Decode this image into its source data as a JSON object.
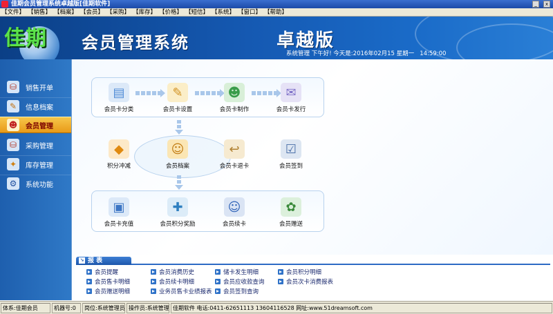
{
  "window": {
    "title": "佳期会员管理系统卓越版[佳期软件]",
    "min_label": "_",
    "close_label": "x"
  },
  "menu": [
    "【文件】",
    "【销售】",
    "【档案】",
    "【会员】",
    "【采购】",
    "【库存】",
    "【价格】",
    "【短信】",
    "【系统】",
    "【窗口】",
    "【帮助】"
  ],
  "banner": {
    "logo": "佳期",
    "app_title": "会员管理系统",
    "edition": "卓越版",
    "status_line": "系统管理 下午好! 今天是:2016年02月15 星期一   14:59:00"
  },
  "sidebar": {
    "items": [
      {
        "label": "销售开单",
        "icon": "cart-icon"
      },
      {
        "label": "信息档案",
        "icon": "archive-icon"
      },
      {
        "label": "会员管理",
        "icon": "member-icon",
        "active": true
      },
      {
        "label": "采购管理",
        "icon": "purchase-icon"
      },
      {
        "label": "库存管理",
        "icon": "inventory-icon"
      },
      {
        "label": "系统功能",
        "icon": "system-icon"
      }
    ]
  },
  "main": {
    "tiles": [
      {
        "label": "会员卡分类",
        "icon": "card-category-icon",
        "color": "#4f8bd6",
        "glyph": "▤"
      },
      {
        "label": "会员卡设置",
        "icon": "card-settings-icon",
        "color": "#e8b23a",
        "glyph": "✎"
      },
      {
        "label": "会员卡制作",
        "icon": "card-make-icon",
        "color": "#3a9c4a",
        "glyph": "☻"
      },
      {
        "label": "会员卡发行",
        "icon": "card-issue-icon",
        "color": "#7d6fc8",
        "glyph": "✉"
      },
      {
        "label": "积分冲减",
        "icon": "points-deduct-icon",
        "color": "#f0a030",
        "glyph": "◆"
      },
      {
        "label": "会员档案",
        "icon": "member-archive-icon",
        "color": "#e0a020",
        "glyph": "☺"
      },
      {
        "label": "会员卡退卡",
        "icon": "card-return-icon",
        "color": "#d8b060",
        "glyph": "↩"
      },
      {
        "label": "会员签到",
        "icon": "checkin-icon",
        "color": "#5a7fb8",
        "glyph": "☑"
      },
      {
        "label": "会员卡充值",
        "icon": "card-recharge-icon",
        "color": "#4d86cf",
        "glyph": "▣"
      },
      {
        "label": "会员积分奖励",
        "icon": "points-reward-icon",
        "color": "#3c8fd0",
        "glyph": "✚"
      },
      {
        "label": "会员续卡",
        "icon": "card-renew-icon",
        "color": "#2f63b8",
        "glyph": "☺"
      },
      {
        "label": "会员赠送",
        "icon": "gift-icon",
        "color": "#4a9a4a",
        "glyph": "✿"
      }
    ]
  },
  "reports": {
    "title": "报 表",
    "links": [
      "会员提醒",
      "会员消费历史",
      "储卡发生明细",
      "会员积分明细",
      "会员售卡明细",
      "会员续卡明细",
      "会员应收款查询",
      "会员次卡消费报表",
      "会员赠送明细",
      "业务员售卡业绩报表",
      "会员签到查询"
    ]
  },
  "statusbar": {
    "store": "体系:佳期会员",
    "machine": "机器号:0",
    "position": "岗位:系统管理员",
    "operator": "操作员:系统管理",
    "company": "佳期软件 电话:0411-62651113  13604116528 网址:www.51dreamsoft.com"
  },
  "colors": {
    "accent": "#1b4aa8",
    "sidebar": "#2f79c7",
    "active": "#f0b030"
  }
}
